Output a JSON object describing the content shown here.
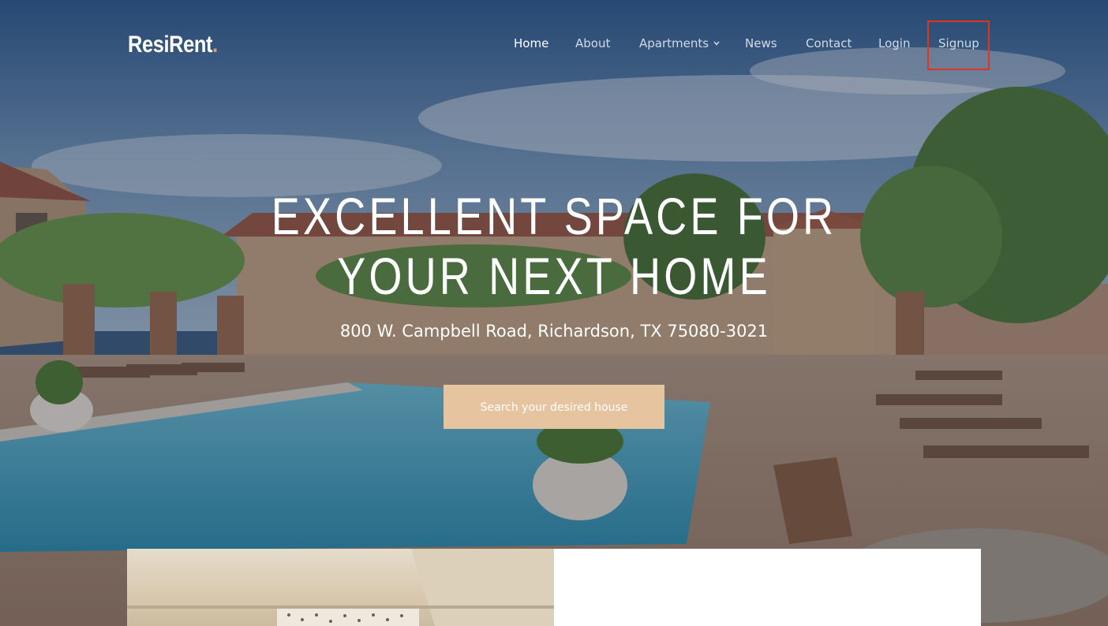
{
  "brand": {
    "name": "ResiRent",
    "dot": ".",
    "accent_color": "#e89a66"
  },
  "nav": {
    "items": [
      {
        "label": "Home",
        "active": true
      },
      {
        "label": "About",
        "active": false
      },
      {
        "label": "Apartments",
        "active": false,
        "has_dropdown": true
      },
      {
        "label": "News",
        "active": false
      },
      {
        "label": "Contact",
        "active": false
      },
      {
        "label": "Login",
        "active": false
      },
      {
        "label": "Signup",
        "active": false,
        "highlighted": true
      }
    ],
    "highlight_color": "#e0341d"
  },
  "hero": {
    "headline_line1": "EXCELLENT SPACE FOR",
    "headline_line2": "YOUR NEXT HOME",
    "address": "800 W. Campbell Road, Richardson, TX 75080-3021",
    "cta_label": "Search your desired house",
    "cta_color": "#e7c4a0"
  }
}
